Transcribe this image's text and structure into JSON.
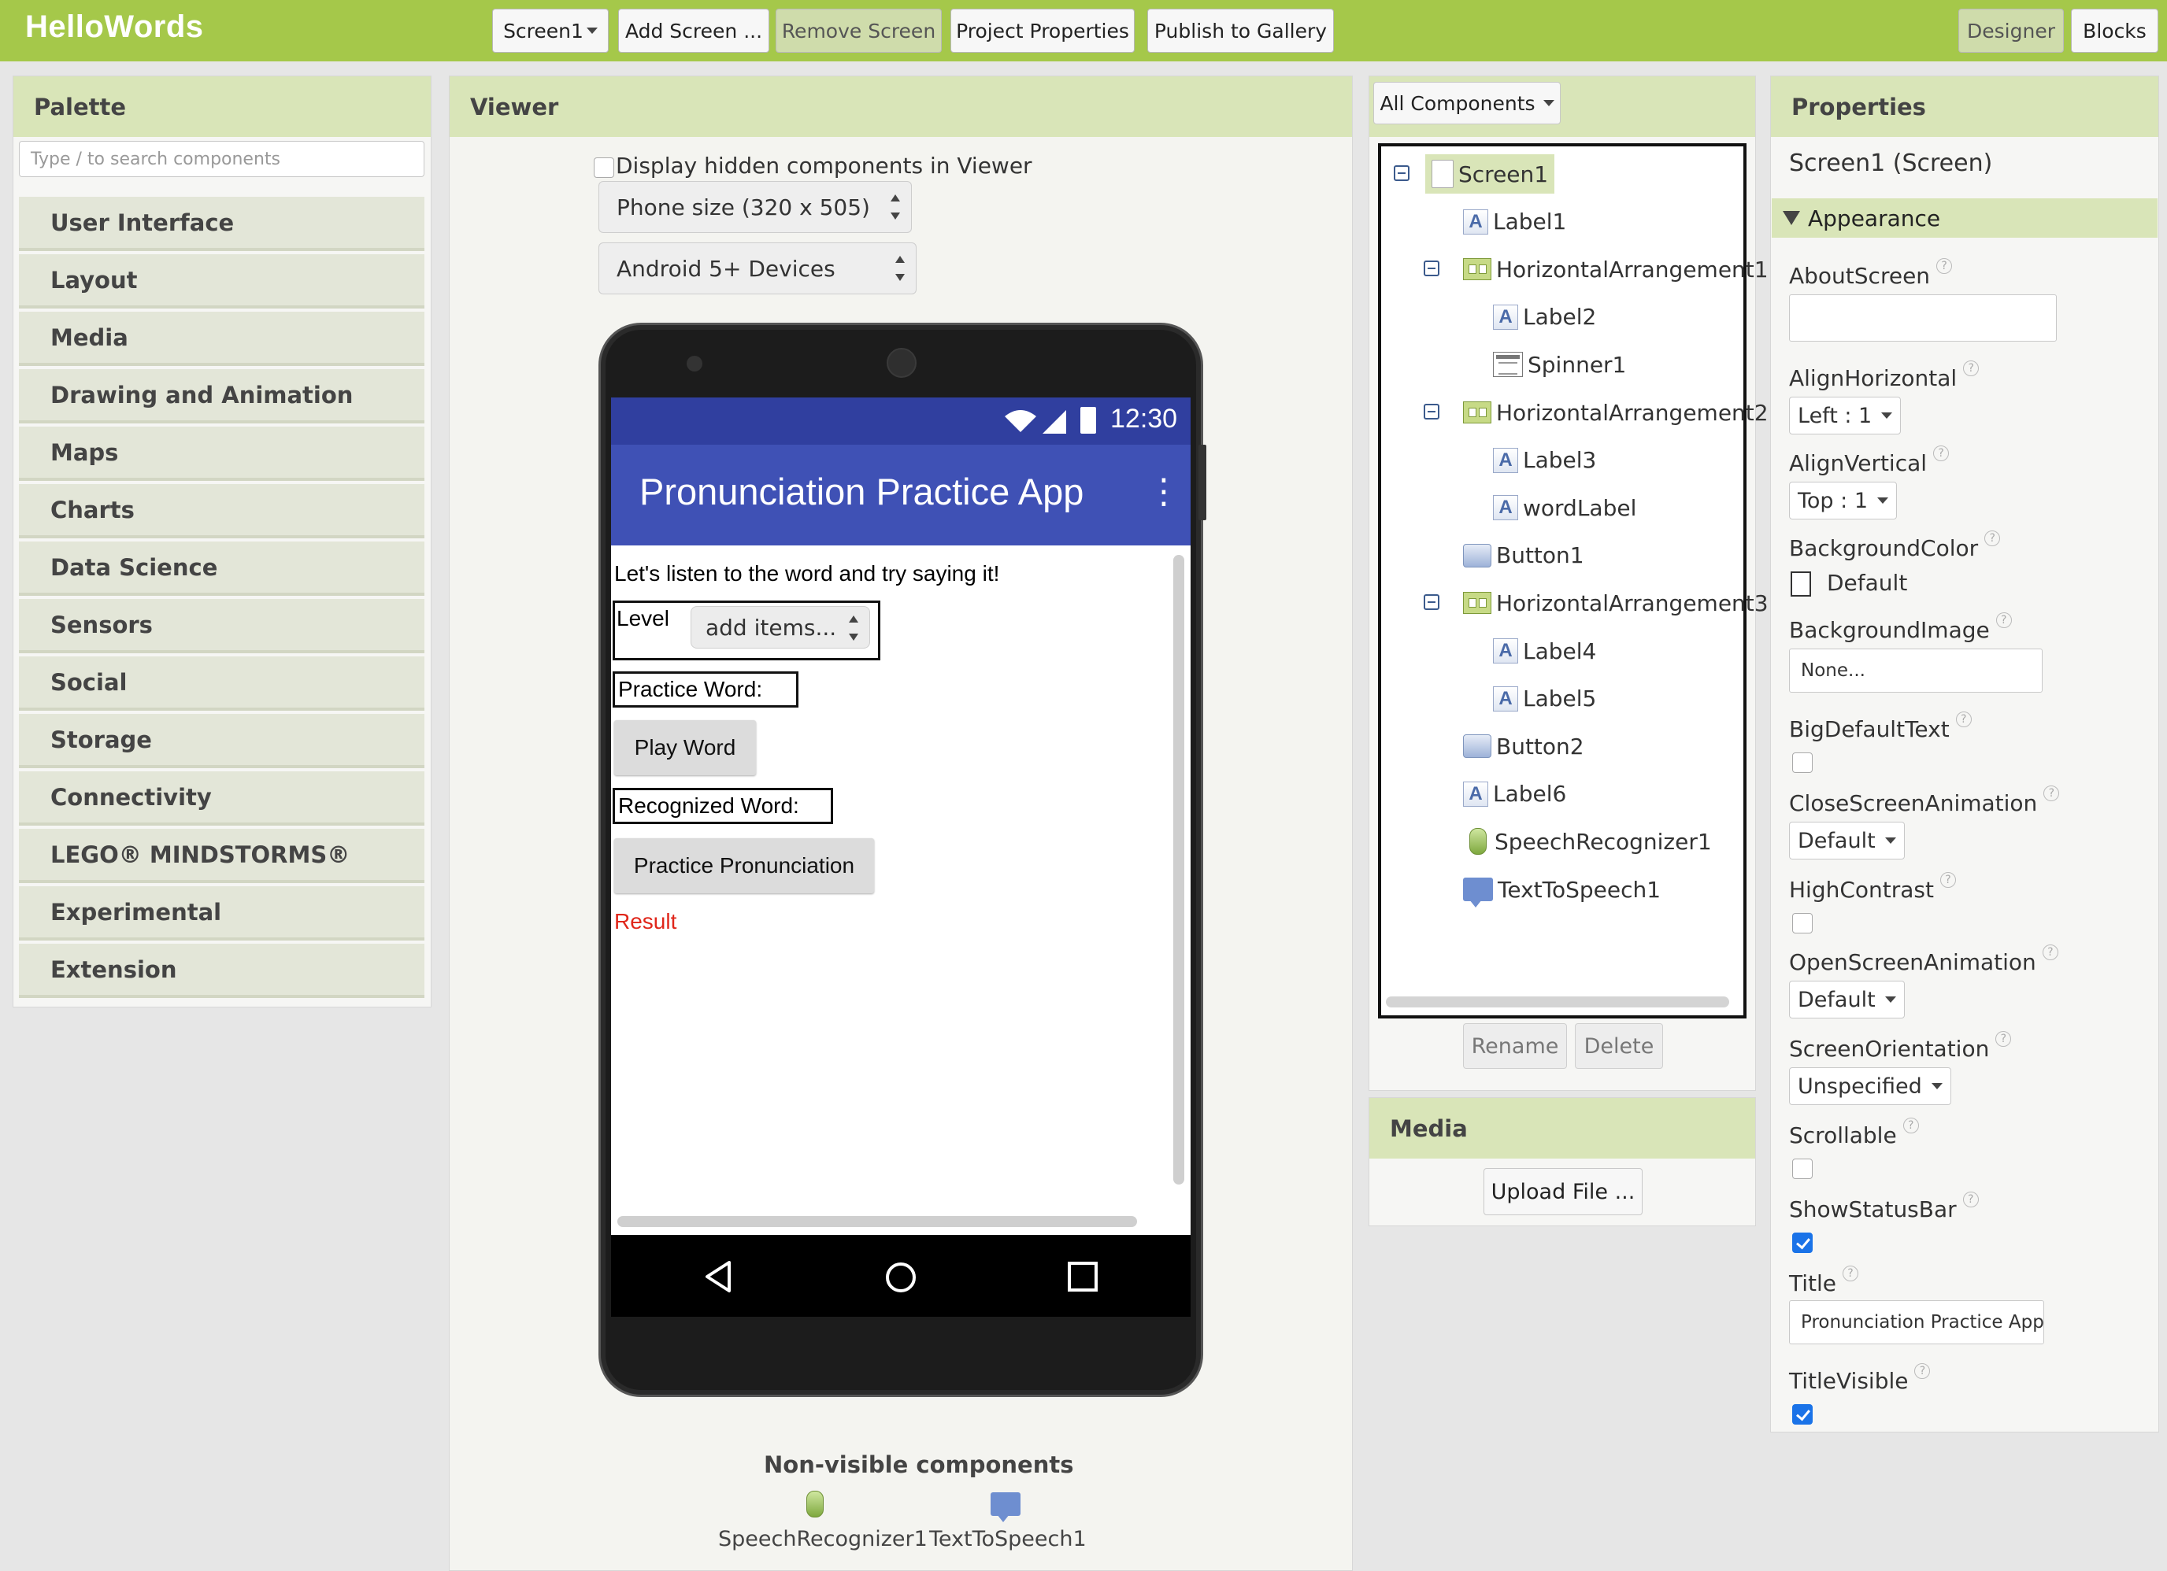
{
  "app": {
    "title": "HelloWords"
  },
  "toolbar": {
    "screen_select": "Screen1",
    "add_screen": "Add Screen ...",
    "remove_screen": "Remove Screen",
    "project_properties": "Project Properties",
    "publish": "Publish to Gallery",
    "designer": "Designer",
    "blocks": "Blocks"
  },
  "palette": {
    "title": "Palette",
    "search_placeholder": "Type / to search components",
    "categories": [
      "User Interface",
      "Layout",
      "Media",
      "Drawing and Animation",
      "Maps",
      "Charts",
      "Data Science",
      "Sensors",
      "Social",
      "Storage",
      "Connectivity",
      "LEGO® MINDSTORMS®",
      "Experimental",
      "Extension"
    ]
  },
  "viewer": {
    "title": "Viewer",
    "hidden_toggle_label": "Display hidden components in Viewer",
    "size_select": "Phone size (320 x 505)",
    "device_select": "Android 5+ Devices",
    "phone": {
      "clock": "12:30",
      "app_title": "Pronunciation Practice App",
      "menu_glyph": "⋮",
      "intro_label": "Let's listen to the word and try saying it!",
      "level_label": "Level",
      "spinner_text": "add items...",
      "practice_word_label": "Practice Word:",
      "play_button": "Play Word",
      "recognized_label": "Recognized Word:",
      "practice_button": "Practice Pronunciation",
      "result_label": "Result",
      "result_color": "#e0261a"
    },
    "nonvisible_title": "Non-visible components",
    "nonvisible": [
      "SpeechRecognizer1",
      "TextToSpeech1"
    ]
  },
  "components": {
    "filter": "All Components",
    "tree": [
      {
        "name": "Screen1",
        "icon": "screen-icon"
      },
      {
        "name": "Label1",
        "icon": "label-icon"
      },
      {
        "name": "HorizontalArrangement1",
        "icon": "horizontal-arrangement-icon"
      },
      {
        "name": "Label2",
        "icon": "label-icon"
      },
      {
        "name": "Spinner1",
        "icon": "spinner-icon"
      },
      {
        "name": "HorizontalArrangement2",
        "icon": "horizontal-arrangement-icon"
      },
      {
        "name": "Label3",
        "icon": "label-icon"
      },
      {
        "name": "wordLabel",
        "icon": "label-icon"
      },
      {
        "name": "Button1",
        "icon": "button-icon"
      },
      {
        "name": "HorizontalArrangement3",
        "icon": "horizontal-arrangement-icon"
      },
      {
        "name": "Label4",
        "icon": "label-icon"
      },
      {
        "name": "Label5",
        "icon": "label-icon"
      },
      {
        "name": "Button2",
        "icon": "button-icon"
      },
      {
        "name": "Label6",
        "icon": "label-icon"
      },
      {
        "name": "SpeechRecognizer1",
        "icon": "speech-recognizer-icon"
      },
      {
        "name": "TextToSpeech1",
        "icon": "text-to-speech-icon"
      }
    ],
    "rename": "Rename",
    "delete": "Delete"
  },
  "media": {
    "title": "Media",
    "upload": "Upload File ..."
  },
  "properties": {
    "title": "Properties",
    "subject": "Screen1 (Screen)",
    "section": "Appearance",
    "about_screen": {
      "label": "AboutScreen",
      "value": ""
    },
    "align_horizontal": {
      "label": "AlignHorizontal",
      "value": "Left : 1"
    },
    "align_vertical": {
      "label": "AlignVertical",
      "value": "Top : 1"
    },
    "background_color": {
      "label": "BackgroundColor",
      "value": "Default"
    },
    "background_image": {
      "label": "BackgroundImage",
      "value": "None..."
    },
    "big_default_text": {
      "label": "BigDefaultText",
      "checked": false
    },
    "close_animation": {
      "label": "CloseScreenAnimation",
      "value": "Default"
    },
    "high_contrast": {
      "label": "HighContrast",
      "checked": false
    },
    "open_animation": {
      "label": "OpenScreenAnimation",
      "value": "Default"
    },
    "screen_orientation": {
      "label": "ScreenOrientation",
      "value": "Unspecified"
    },
    "scrollable": {
      "label": "Scrollable",
      "checked": false
    },
    "show_status_bar": {
      "label": "ShowStatusBar",
      "checked": true
    },
    "title_prop": {
      "label": "Title",
      "value": "Pronunciation Practice App"
    },
    "title_visible": {
      "label": "TitleVisible",
      "checked": true
    },
    "help_glyph": "?"
  },
  "colors": {
    "brand": "#a5c84a",
    "header": "#d9e5b8",
    "phone_appbar": "#3f51b5",
    "status_bar": "#303f9f"
  }
}
